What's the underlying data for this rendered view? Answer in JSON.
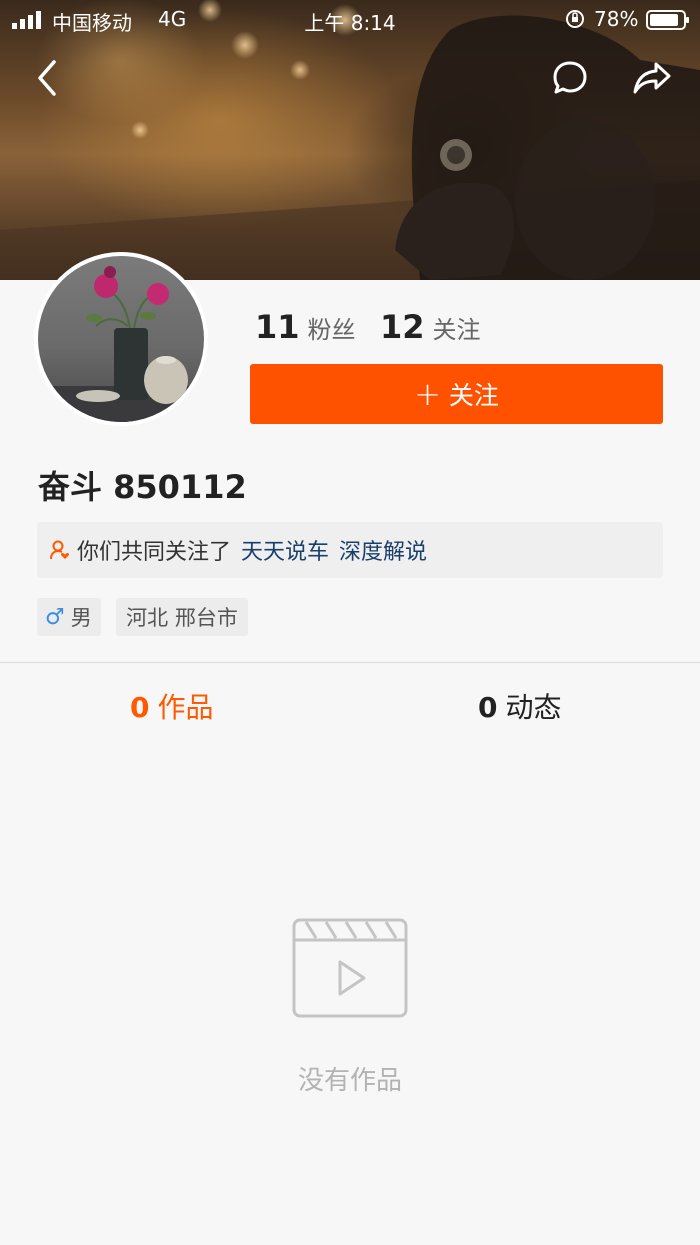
{
  "status_bar": {
    "carrier": "中国移动",
    "network": "4G",
    "time": "上午 8:14",
    "battery": "78%"
  },
  "nav": {
    "back_icon": "chevron-left-icon",
    "message_icon": "chat-bubble-icon",
    "share_icon": "share-icon"
  },
  "profile": {
    "username": "奋斗 850112",
    "fans_count": "11",
    "fans_label": "粉丝",
    "following_count": "12",
    "following_label": "关注",
    "follow_button": {
      "plus": "+",
      "label": "关注"
    },
    "mutual": {
      "text": "你们共同关注了",
      "links": [
        "天天说车",
        "深度解说"
      ]
    },
    "tags": {
      "gender_symbol": "♂",
      "gender": "男",
      "region": "河北 邢台市"
    }
  },
  "tabs": [
    {
      "count": "0",
      "label": "作品",
      "active": true
    },
    {
      "count": "0",
      "label": "动态",
      "active": false
    }
  ],
  "empty_state": {
    "icon": "video-clapper-icon",
    "text": "没有作品"
  },
  "colors": {
    "accent": "#ff5200",
    "link": "#1a3f6b",
    "gender_male": "#3a8ee6"
  }
}
